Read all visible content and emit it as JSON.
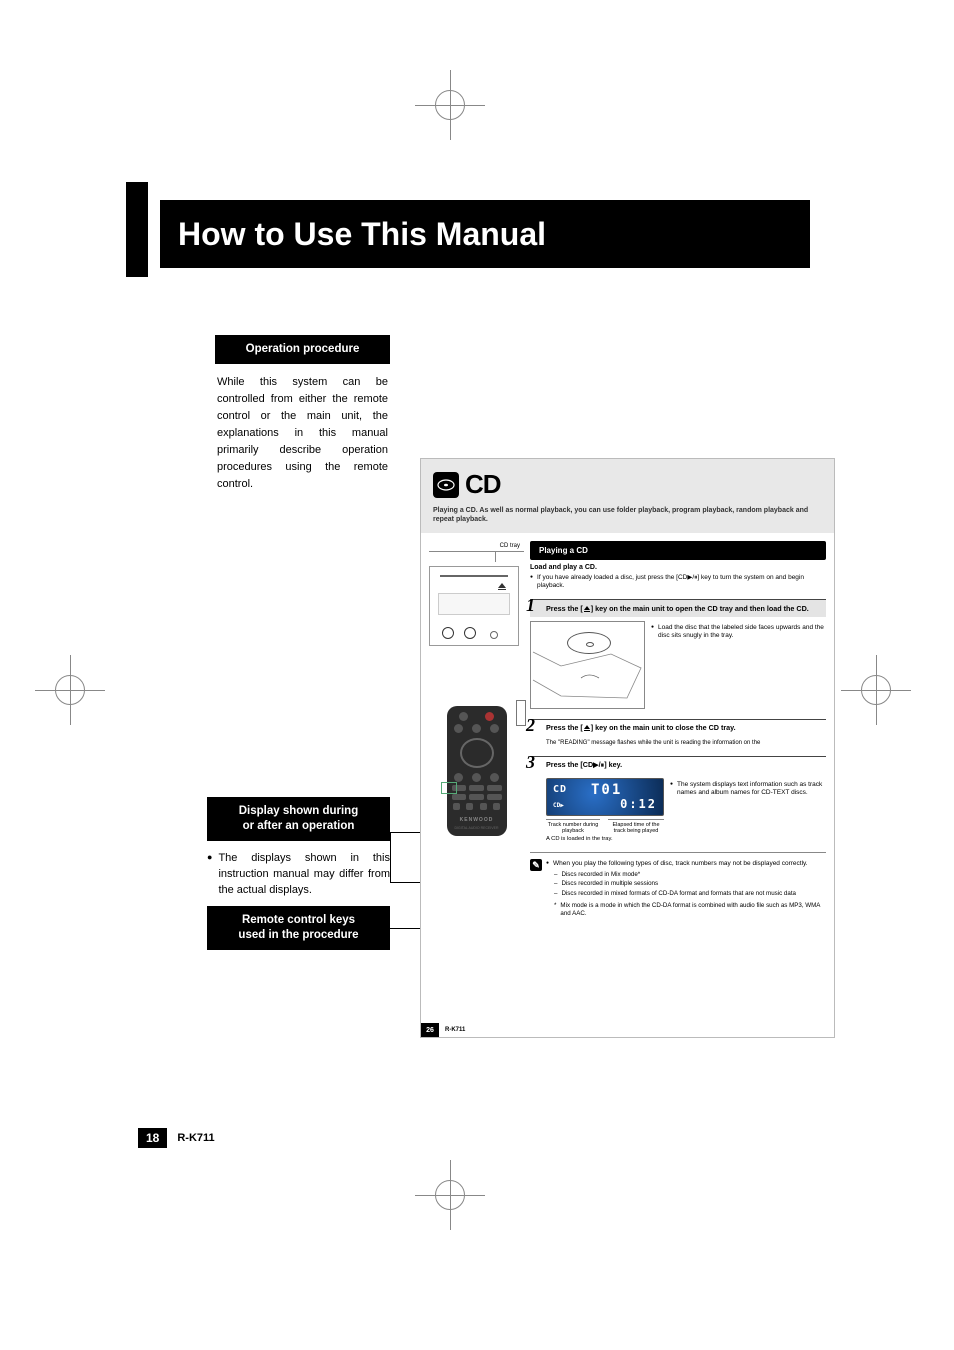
{
  "page": {
    "title": "How to Use This Manual",
    "number": "18",
    "model": "R-K711"
  },
  "callouts": {
    "operation": {
      "heading": "Operation procedure",
      "body": "While this system can be controlled from either the remote control or the main unit, the explanations in this manual primarily describe operation procedures using the remote control."
    },
    "display": {
      "heading_line1": "Display shown during",
      "heading_line2": "or after an operation",
      "bullet": "The displays shown in this instruction manual may differ from the actual displays."
    },
    "remote": {
      "heading_line1": "Remote control keys",
      "heading_line2": "used in the procedure"
    }
  },
  "embedded": {
    "icon_label": "disc",
    "title": "CD",
    "subtitle": "Playing a CD. As well as normal playback, you can use folder playback, program playback, random playback and repeat playback.",
    "left": {
      "cd_tray_label": "CD tray",
      "brand": "KENWOOD",
      "brand_sub": "DIGITAL AUDIO RECEIVER"
    },
    "play": {
      "heading": "Playing a CD",
      "sub": "Load and play a CD.",
      "intro": "If you have already loaded a disc, just press the [CD▶/⏸] key to turn the system on and begin playback."
    },
    "step1": {
      "num": "1",
      "heading": "Press the [ ⏏ ] key on the main unit to open the CD tray and then load the CD.",
      "bullet": "Load the disc that the labeled side faces upwards and the disc sits snugly in the tray."
    },
    "step2": {
      "num": "2",
      "heading": "Press the [ ⏏ ] key on the main unit to close the CD tray.",
      "note": "The \"READING\" message flashes while the unit is reading the information on the"
    },
    "step3": {
      "num": "3",
      "heading": "Press the [CD▶/⏸] key.",
      "lcd": {
        "cd": "CD",
        "track": "T01",
        "play": "CD▶",
        "time": "0:12"
      },
      "label_track": "Track number during playback",
      "label_time": "Elapsed time of the track being played",
      "caption": "A CD is loaded in the tray.",
      "side": "The system displays text information such as track names and album names for CD-TEXT discs."
    },
    "notes": {
      "note0": "When you play the following types of disc, track numbers may not be displayed correctly.",
      "note1": "Discs recorded in Mix mode*",
      "note2": "Discs recorded in multiple sessions",
      "note3": "Discs recorded in mixed formats of CD-DA format and formats that are not music data",
      "footnote": "Mix mode is a mode in which the CD-DA format is combined with audio file such as MP3, WMA and AAC."
    },
    "footer": {
      "page": "26",
      "model": "R-K711"
    }
  }
}
